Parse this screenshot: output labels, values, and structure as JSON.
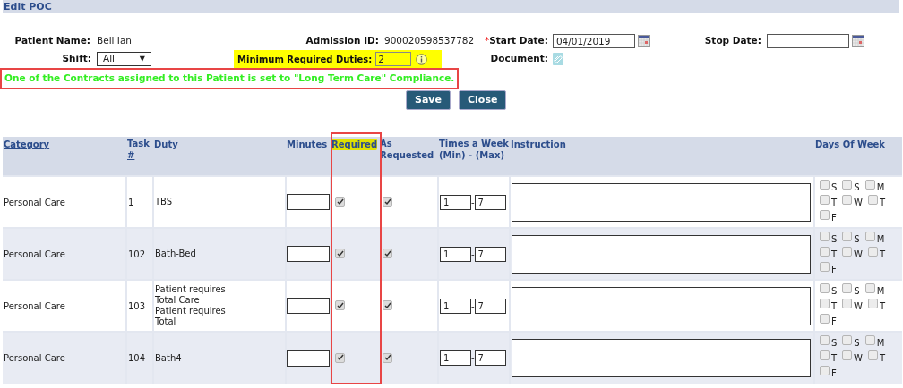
{
  "title": "Edit POC",
  "form": {
    "patient_name_label": "Patient Name:",
    "patient_name": "Bell Ian",
    "admission_label": "Admission ID:",
    "admission_id": "900020598537782",
    "required_mark": "*",
    "start_label": "Start Date:",
    "start_date": "04/01/2019",
    "stop_label": "Stop Date:",
    "shift_label": "Shift:",
    "shift": "All",
    "shift_caret": "▼",
    "min_duties_label": "Minimum Required Duties:",
    "min_duties": "2",
    "document_label": "Document:"
  },
  "message": "One of the Contracts assigned to this Patient is set to \"Long Term Care\" Compliance.",
  "buttons": [
    "Save",
    "Close"
  ],
  "table": {
    "columns": [
      {
        "label": "Category",
        "link": true
      },
      {
        "label": "Task #",
        "link": true
      },
      {
        "label": "Duty",
        "link": false
      },
      {
        "label": "Minutes",
        "link": false
      },
      {
        "label": "Required",
        "link": false
      },
      {
        "label": "As Requested",
        "link": false
      },
      {
        "label": "Times a Week (Min) - (Max)",
        "link": false
      },
      {
        "label": "Instruction",
        "link": false
      },
      {
        "label": "Days Of Week",
        "link": false
      }
    ],
    "rows": [
      {
        "category": "Personal Care",
        "task": "1",
        "duty": "TBS",
        "minutes": "",
        "required": true,
        "as_requested": true,
        "min": "1",
        "dash": "-",
        "max": "7",
        "instruction": "",
        "days": [
          {
            "label": "S",
            "checked": false
          },
          {
            "label": "S",
            "checked": false
          },
          {
            "label": "M",
            "checked": false
          },
          {
            "label": "T",
            "checked": false
          },
          {
            "label": "W",
            "checked": false
          },
          {
            "label": "T",
            "checked": false
          },
          {
            "label": "F",
            "checked": false
          }
        ]
      },
      {
        "category": "Personal Care",
        "task": "102",
        "duty": "Bath-Bed",
        "minutes": "",
        "required": true,
        "as_requested": true,
        "min": "1",
        "dash": "-",
        "max": "7",
        "instruction": "",
        "days": [
          {
            "label": "S",
            "checked": false
          },
          {
            "label": "S",
            "checked": false
          },
          {
            "label": "M",
            "checked": false
          },
          {
            "label": "T",
            "checked": false
          },
          {
            "label": "W",
            "checked": false
          },
          {
            "label": "T",
            "checked": false
          },
          {
            "label": "F",
            "checked": false
          }
        ]
      },
      {
        "category": "Personal Care",
        "task": "103",
        "duty": "Patient requires Total Care Patient requires Total",
        "minutes": "",
        "required": true,
        "as_requested": true,
        "min": "1",
        "dash": "-",
        "max": "7",
        "instruction": "",
        "days": [
          {
            "label": "S",
            "checked": false
          },
          {
            "label": "S",
            "checked": false
          },
          {
            "label": "M",
            "checked": false
          },
          {
            "label": "T",
            "checked": false
          },
          {
            "label": "W",
            "checked": false
          },
          {
            "label": "T",
            "checked": false
          },
          {
            "label": "F",
            "checked": false
          }
        ]
      },
      {
        "category": "Personal Care",
        "task": "104",
        "duty": "Bath4",
        "minutes": "",
        "required": true,
        "as_requested": true,
        "min": "1",
        "dash": "-",
        "max": "7",
        "instruction": "",
        "days": [
          {
            "label": "S",
            "checked": false
          },
          {
            "label": "S",
            "checked": false
          },
          {
            "label": "M",
            "checked": false
          },
          {
            "label": "T",
            "checked": false
          },
          {
            "label": "W",
            "checked": false
          },
          {
            "label": "T",
            "checked": false
          },
          {
            "label": "F",
            "checked": false
          }
        ]
      }
    ]
  }
}
